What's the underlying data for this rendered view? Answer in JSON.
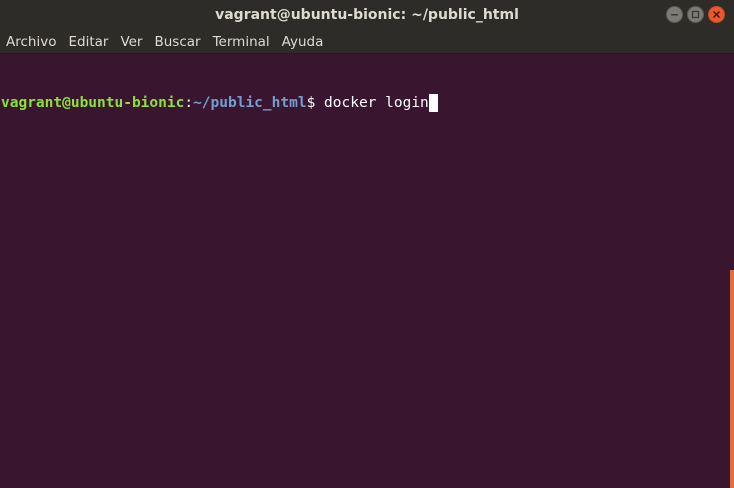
{
  "window": {
    "title": "vagrant@ubuntu-bionic: ~/public_html"
  },
  "window_controls": {
    "minimize_icon": "minimize-icon",
    "maximize_icon": "maximize-icon",
    "close_icon": "close-icon"
  },
  "menu": {
    "items": [
      "Archivo",
      "Editar",
      "Ver",
      "Buscar",
      "Terminal",
      "Ayuda"
    ]
  },
  "terminal": {
    "prompt_user": "vagrant@ubuntu-bionic",
    "prompt_colon": ":",
    "prompt_path": "~/public_html",
    "prompt_symbol": "$ ",
    "command": "docker login"
  },
  "colors": {
    "background": "#3a1530",
    "prompt_user": "#8ae234",
    "prompt_path": "#729fcf",
    "scrollbar_thumb": "#e06f3d"
  }
}
